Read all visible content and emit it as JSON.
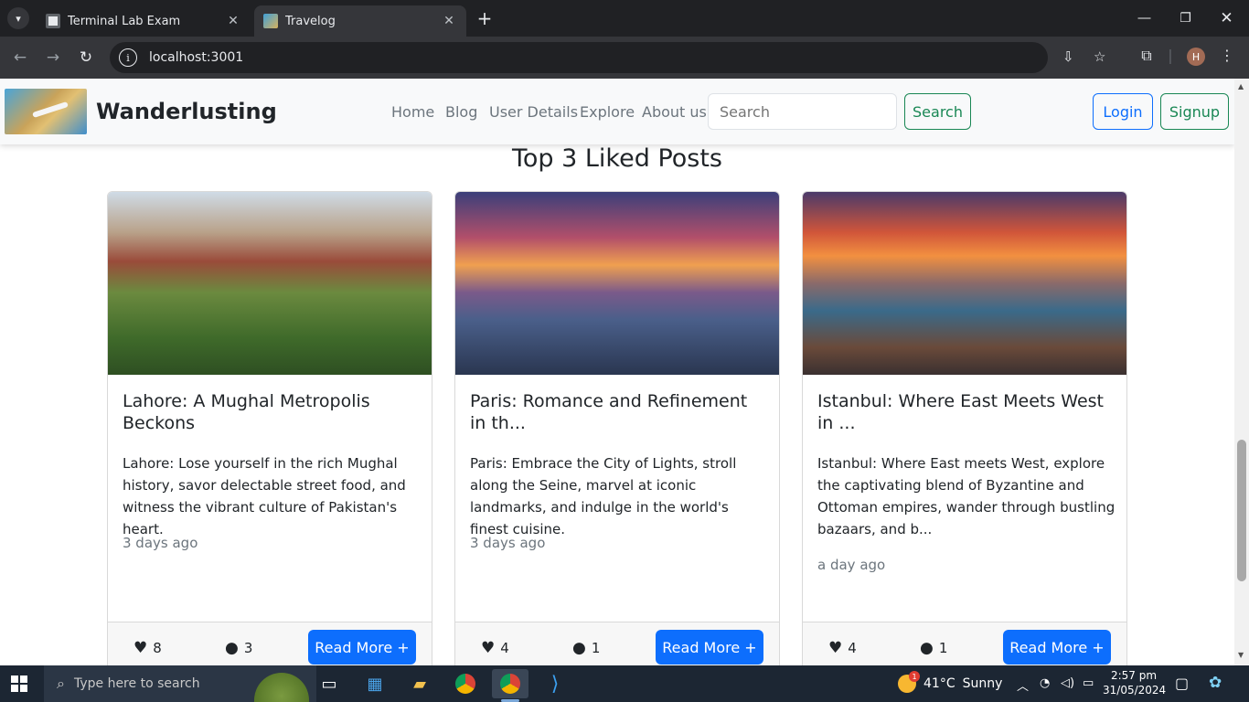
{
  "browser": {
    "tabs": [
      {
        "title": "Terminal Lab Exam",
        "active": false
      },
      {
        "title": "Travelog",
        "active": true
      }
    ],
    "url": "localhost:3001",
    "profile_initial": "H"
  },
  "navbar": {
    "brand": "Wanderlusting",
    "links": [
      "Home",
      "Blog",
      "User Details",
      "Explore",
      "About us"
    ],
    "search_placeholder": "Search",
    "search_button": "Search",
    "login": "Login",
    "signup": "Signup"
  },
  "section": {
    "heading": "Top 3 Liked Posts"
  },
  "posts": [
    {
      "title": "Lahore: A Mughal Metropolis Beckons",
      "excerpt": "Lahore: Lose yourself in the rich Mughal history, savor delectable street food, and witness the vibrant culture of Pakistan's heart.",
      "age": "3 days ago",
      "likes": "8",
      "comments": "3",
      "button": "Read More +"
    },
    {
      "title": "Paris: Romance and Refinement in th...",
      "excerpt": "Paris: Embrace the City of Lights, stroll along the Seine, marvel at iconic landmarks, and indulge in the world's finest cuisine.",
      "age": "3 days ago",
      "likes": "4",
      "comments": "1",
      "button": "Read More +"
    },
    {
      "title": "Istanbul: Where East Meets West in ...",
      "excerpt": "Istanbul: Where East meets West, explore the captivating blend of Byzantine and Ottoman empires, wander through bustling bazaars, and b...",
      "age": "a day ago",
      "likes": "4",
      "comments": "1",
      "button": "Read More +"
    }
  ],
  "taskbar": {
    "search_placeholder": "Type here to search",
    "weather_temp": "41°C",
    "weather_text": "Sunny",
    "weather_badge": "1",
    "time": "2:57 pm",
    "date": "31/05/2024"
  }
}
